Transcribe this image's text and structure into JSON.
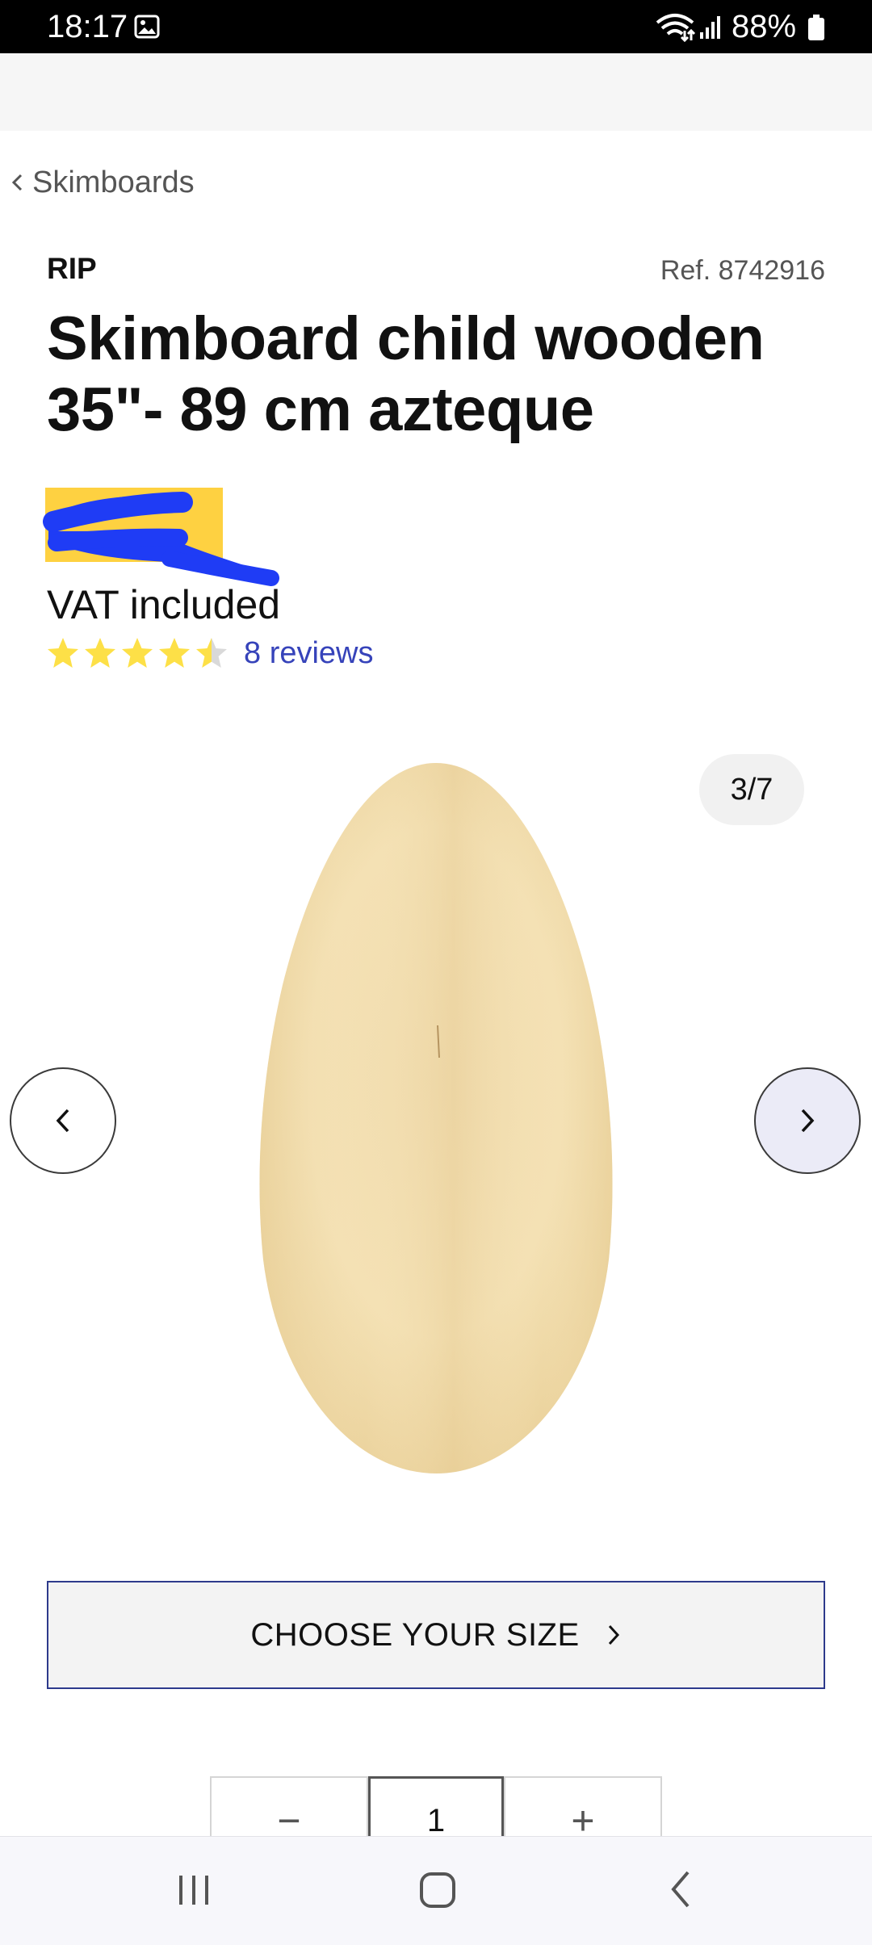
{
  "status_bar": {
    "time": "18:17",
    "battery": "88%",
    "icons": [
      "gallery-icon",
      "wifi-icon",
      "signal-icon",
      "battery-icon"
    ]
  },
  "breadcrumb": {
    "label": "Skimboards",
    "icon": "chevron-left-icon"
  },
  "product": {
    "brand": "RIP",
    "ref": "Ref. 8742916",
    "title": "Skimboard child wooden 35\"- 89 cm azteque",
    "price_partial": "                                    ",
    "vat": "VAT included",
    "rating": 4.5,
    "rating_max": 5,
    "reviews": "8 reviews"
  },
  "gallery": {
    "counter": "3/7",
    "prev_icon": "chevron-left-icon",
    "next_icon": "chevron-right-icon",
    "image": "wooden-skimboard-image"
  },
  "actions": {
    "choose_size": "CHOOSE YOUR SIZE",
    "choose_size_icon": "chevron-right-icon"
  },
  "quantity": {
    "minus": "−",
    "value": "1",
    "plus": "+"
  },
  "system_nav": {
    "icons": [
      "recent-apps-icon",
      "home-icon",
      "back-icon"
    ]
  },
  "colors": {
    "price_background": "#fed141",
    "link": "#3643ba",
    "button_border": "#2d3a8c",
    "star": "#fde047",
    "redaction": "#1f3cf5"
  }
}
